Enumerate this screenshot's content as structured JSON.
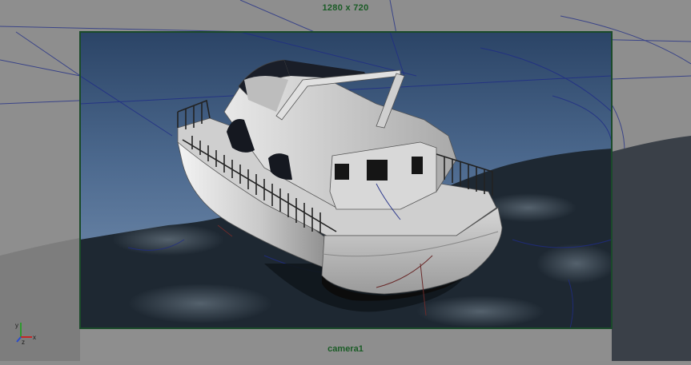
{
  "viewport": {
    "resolution_label": "1280 x 720",
    "camera_name": "camera1",
    "axes": {
      "x": "x",
      "y": "y",
      "z": "z"
    },
    "colors": {
      "background": "#8d8d8d",
      "resolution_gate": "#1a4a2a",
      "grid_lines": "#1f2c86",
      "label_text": "#1a5c26",
      "sky_top": "#2b4466",
      "sky_bottom": "#7a94b4"
    }
  }
}
